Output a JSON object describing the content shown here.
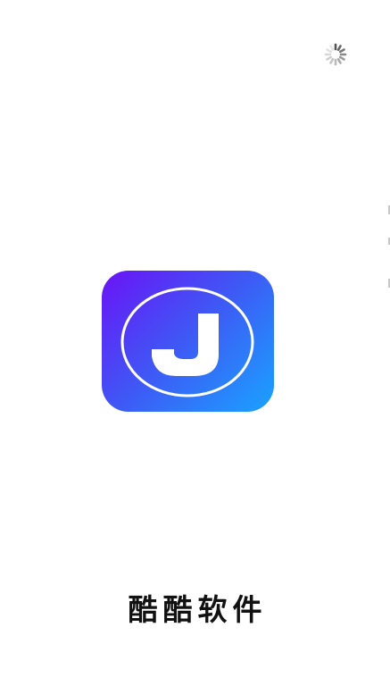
{
  "splash": {
    "app_name": "酷酷软件",
    "logo_letter": "J",
    "loading_icon": "loading-spinner-icon",
    "colors": {
      "background": "#ffffff",
      "logo_gradient_start": "#6a13f6",
      "logo_gradient_end": "#1aa3ff",
      "text": "#111111"
    }
  }
}
